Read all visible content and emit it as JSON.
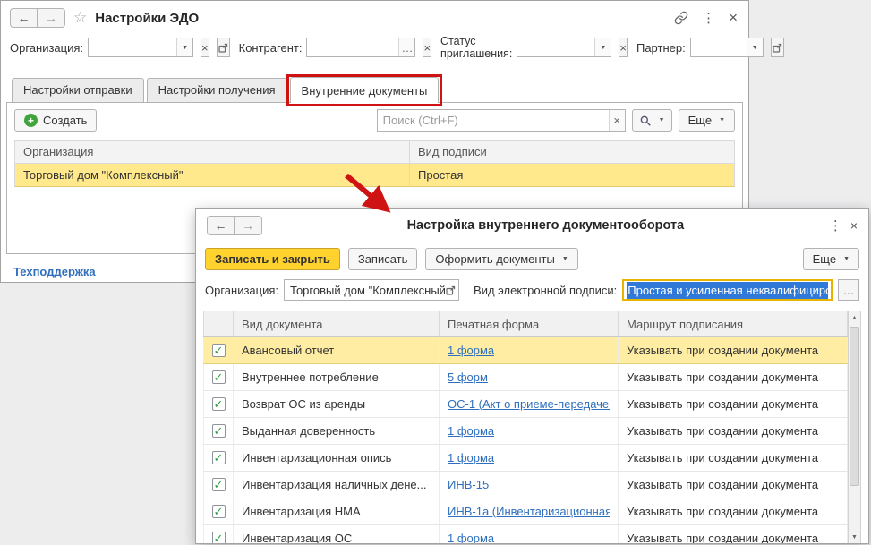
{
  "colors": {
    "accent_yellow": "#ffd22e",
    "row_selection_yellow": "#ffe98c",
    "text_selection_blue": "#3079d8",
    "link_blue": "#2f6fbe",
    "annotation_red": "#cf1313",
    "check_green": "#2f9e44"
  },
  "icons": {
    "back": "←",
    "forward": "→",
    "star": "☆",
    "kebab": "⋮",
    "close": "×",
    "dropdown": "▼",
    "clear": "×",
    "ellipsis": "…",
    "check": "✓",
    "scroll_up": "▲",
    "scroll_down": "▼",
    "plus": "+"
  },
  "main_window": {
    "title": "Настройки ЭДО",
    "filters": {
      "organization_label": "Организация:",
      "counterparty_label": "Контрагент:",
      "invitation_status_label": "Статус приглашения:",
      "partner_label": "Партнер:"
    },
    "tabs": [
      {
        "label": "Настройки отправки"
      },
      {
        "label": "Настройки получения"
      },
      {
        "label": "Внутренние документы"
      }
    ],
    "toolbar": {
      "create_label": "Создать",
      "search_placeholder": "Поиск (Ctrl+F)",
      "more_label": "Еще"
    },
    "table": {
      "columns": [
        "Организация",
        "Вид подписи"
      ],
      "rows": [
        {
          "organization": "Торговый дом \"Комплексный\"",
          "signature": "Простая"
        }
      ]
    },
    "support_link": "Техподдержка"
  },
  "dialog": {
    "title": "Настройка внутреннего документооборота",
    "buttons": {
      "save_and_close": "Записать и закрыть",
      "save": "Записать",
      "issue_documents": "Оформить документы",
      "more": "Еще"
    },
    "fields": {
      "organization_label": "Организация:",
      "organization_value": "Торговый дом \"Комплексный\"",
      "signature_label": "Вид электронной подписи:",
      "signature_value": "Простая и усиленная неквалифициро"
    },
    "table": {
      "columns": [
        "Вид документа",
        "Печатная форма",
        "Маршрут подписания"
      ],
      "rows": [
        {
          "doc": "Авансовый отчет",
          "form": "1 форма",
          "route": "Указывать при создании документа"
        },
        {
          "doc": "Внутреннее потребление",
          "form": "5 форм",
          "route": "Указывать при создании документа"
        },
        {
          "doc": "Возврат ОС из аренды",
          "form": "ОС-1 (Акт о приеме-передаче...",
          "route": "Указывать при создании документа"
        },
        {
          "doc": "Выданная доверенность",
          "form": "1 форма",
          "route": "Указывать при создании документа"
        },
        {
          "doc": "Инвентаризационная опись",
          "form": "1 форма",
          "route": "Указывать при создании документа"
        },
        {
          "doc": "Инвентаризация наличных дене...",
          "form": "ИНВ-15",
          "route": "Указывать при создании документа"
        },
        {
          "doc": "Инвентаризация НМА",
          "form": "ИНВ-1а (Инвентаризационная...",
          "route": "Указывать при создании документа"
        },
        {
          "doc": "Инвентаризация ОС",
          "form": "1 форма",
          "route": "Указывать при создании документа"
        }
      ]
    }
  }
}
